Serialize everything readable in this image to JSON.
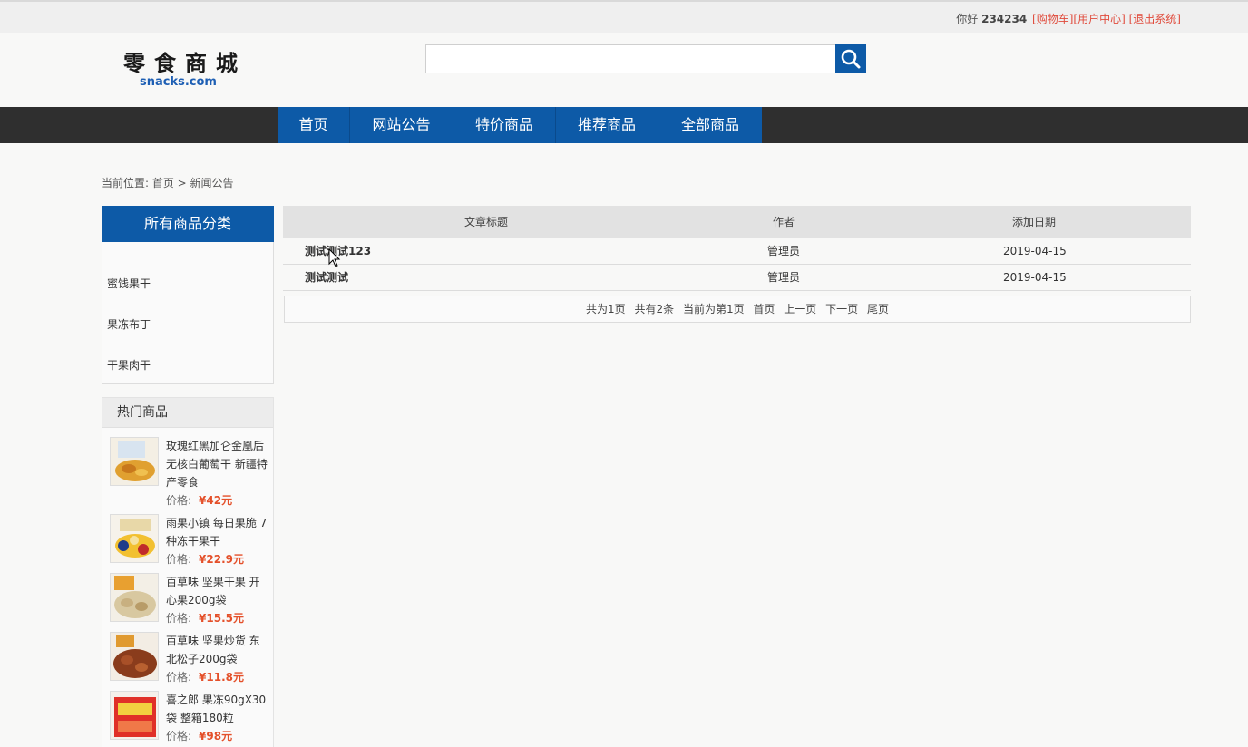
{
  "topbar": {
    "greeting": "你好",
    "username": "234234",
    "links": [
      "[购物车]",
      "[用户中心]",
      "[退出系统]"
    ]
  },
  "logo": {
    "cn": "零食商城",
    "en": "snacks.com"
  },
  "search": {
    "value": "",
    "placeholder": "",
    "icon": "search-icon"
  },
  "nav": {
    "items": [
      "首页",
      "网站公告",
      "特价商品",
      "推荐商品",
      "全部商品"
    ]
  },
  "breadcrumb": "当前位置: 首页 > 新闻公告",
  "categories": {
    "title": "所有商品分类",
    "items": [
      "蜜饯果干",
      "果冻布丁",
      "干果肉干"
    ]
  },
  "hot": {
    "title": "热门商品",
    "price_label": "价格:",
    "items": [
      {
        "name": "玫瑰红黑加仑金凰后无核白葡萄干 新疆特产零食",
        "price": "¥42元"
      },
      {
        "name": "雨果小镇 每日果脆 7种冻干果干",
        "price": "¥22.9元"
      },
      {
        "name": "百草味 坚果干果 开心果200g袋",
        "price": "¥15.5元"
      },
      {
        "name": "百草味 坚果炒货 东北松子200g袋",
        "price": "¥11.8元"
      },
      {
        "name": "喜之郎 果冻90gX30袋 整箱180粒",
        "price": "¥98元"
      }
    ]
  },
  "table": {
    "headers": [
      "文章标题",
      "作者",
      "添加日期"
    ],
    "rows": [
      {
        "title": "测试测试123",
        "author": "管理员",
        "date": "2019-04-15"
      },
      {
        "title": "测试测试",
        "author": "管理员",
        "date": "2019-04-15"
      }
    ]
  },
  "pager": {
    "items": [
      "共为1页",
      "共有2条",
      "当前为第1页",
      "首页",
      "上一页",
      "下一页",
      "尾页"
    ]
  },
  "colors": {
    "brand_blue": "#0d5aa7",
    "nav_dark": "#2f2f2f",
    "price_orange": "#e4502a",
    "link_red": "#e04b3c"
  }
}
